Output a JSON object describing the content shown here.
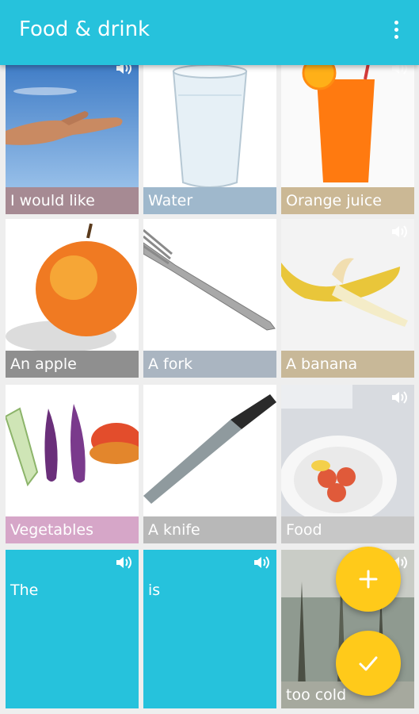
{
  "app": {
    "title": "Food & drink"
  },
  "tiles": [
    {
      "label": "I would like"
    },
    {
      "label": "Water"
    },
    {
      "label": "Orange juice"
    },
    {
      "label": "An apple"
    },
    {
      "label": "A fork"
    },
    {
      "label": "A banana"
    },
    {
      "label": "Vegetables"
    },
    {
      "label": "A knife"
    },
    {
      "label": "Food"
    },
    {
      "label": "The"
    },
    {
      "label": "is"
    },
    {
      "label": "too cold"
    }
  ],
  "icons": {
    "menu": "more-vert-icon",
    "sound": "speaker-icon",
    "add": "plus-icon",
    "done": "check-icon"
  },
  "colors": {
    "appbar": "#26c2dc",
    "fab": "#ffca1a"
  }
}
